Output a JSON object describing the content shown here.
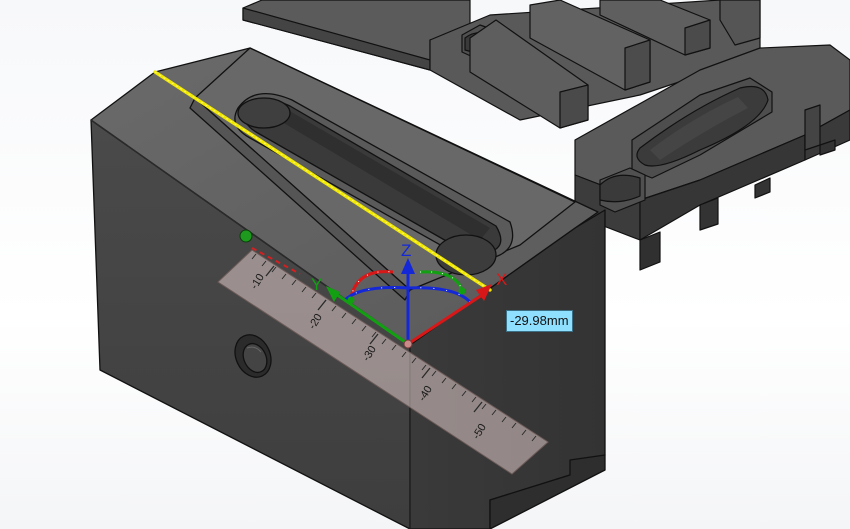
{
  "viewport": {
    "background_color": "#ffffff",
    "model_color": "#4b4b4b"
  },
  "triad": {
    "x_label": "X",
    "y_label": "Y",
    "z_label": "Z",
    "x_color": "#d81818",
    "y_color": "#12a012",
    "z_color": "#1428d8"
  },
  "ruler": {
    "ticks": [
      "-10",
      "-20",
      "-30",
      "-40",
      "-50"
    ]
  },
  "selection": {
    "highlight_color": "#f0e800"
  },
  "dimension": {
    "value": "-29.98mm"
  }
}
